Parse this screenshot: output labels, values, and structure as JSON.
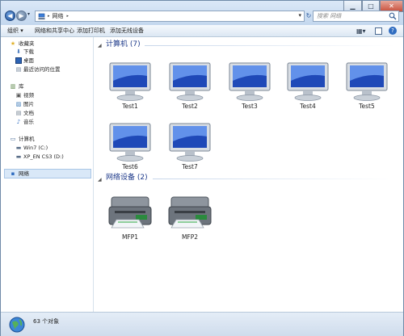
{
  "address": {
    "crumbs": [
      "网络"
    ],
    "search_placeholder": "搜索 网络"
  },
  "toolbar": {
    "organize": "组织",
    "network_center": "网络和共享中心",
    "add_printer": "添加打印机",
    "add_wireless": "添加无线设备"
  },
  "sidebar": {
    "favorites": {
      "label": "收藏夹",
      "items": [
        "下载",
        "桌面",
        "最近访问的位置"
      ]
    },
    "libraries": {
      "label": "库",
      "items": [
        "视频",
        "图片",
        "文档",
        "音乐"
      ]
    },
    "computer": {
      "label": "计算机",
      "items": [
        "Win7 (C:)",
        "XP_EN CS3 (D:)"
      ]
    },
    "network": {
      "label": "网络"
    }
  },
  "groups": {
    "computers": {
      "title": "计算机 (7)",
      "items": [
        "Test1",
        "Test2",
        "Test3",
        "Test4",
        "Test5",
        "Test6",
        "Test7"
      ]
    },
    "devices": {
      "title": "网络设备 (2)",
      "items": [
        "MFP1",
        "MFP2"
      ]
    }
  },
  "status": {
    "text": "63 个对象"
  }
}
